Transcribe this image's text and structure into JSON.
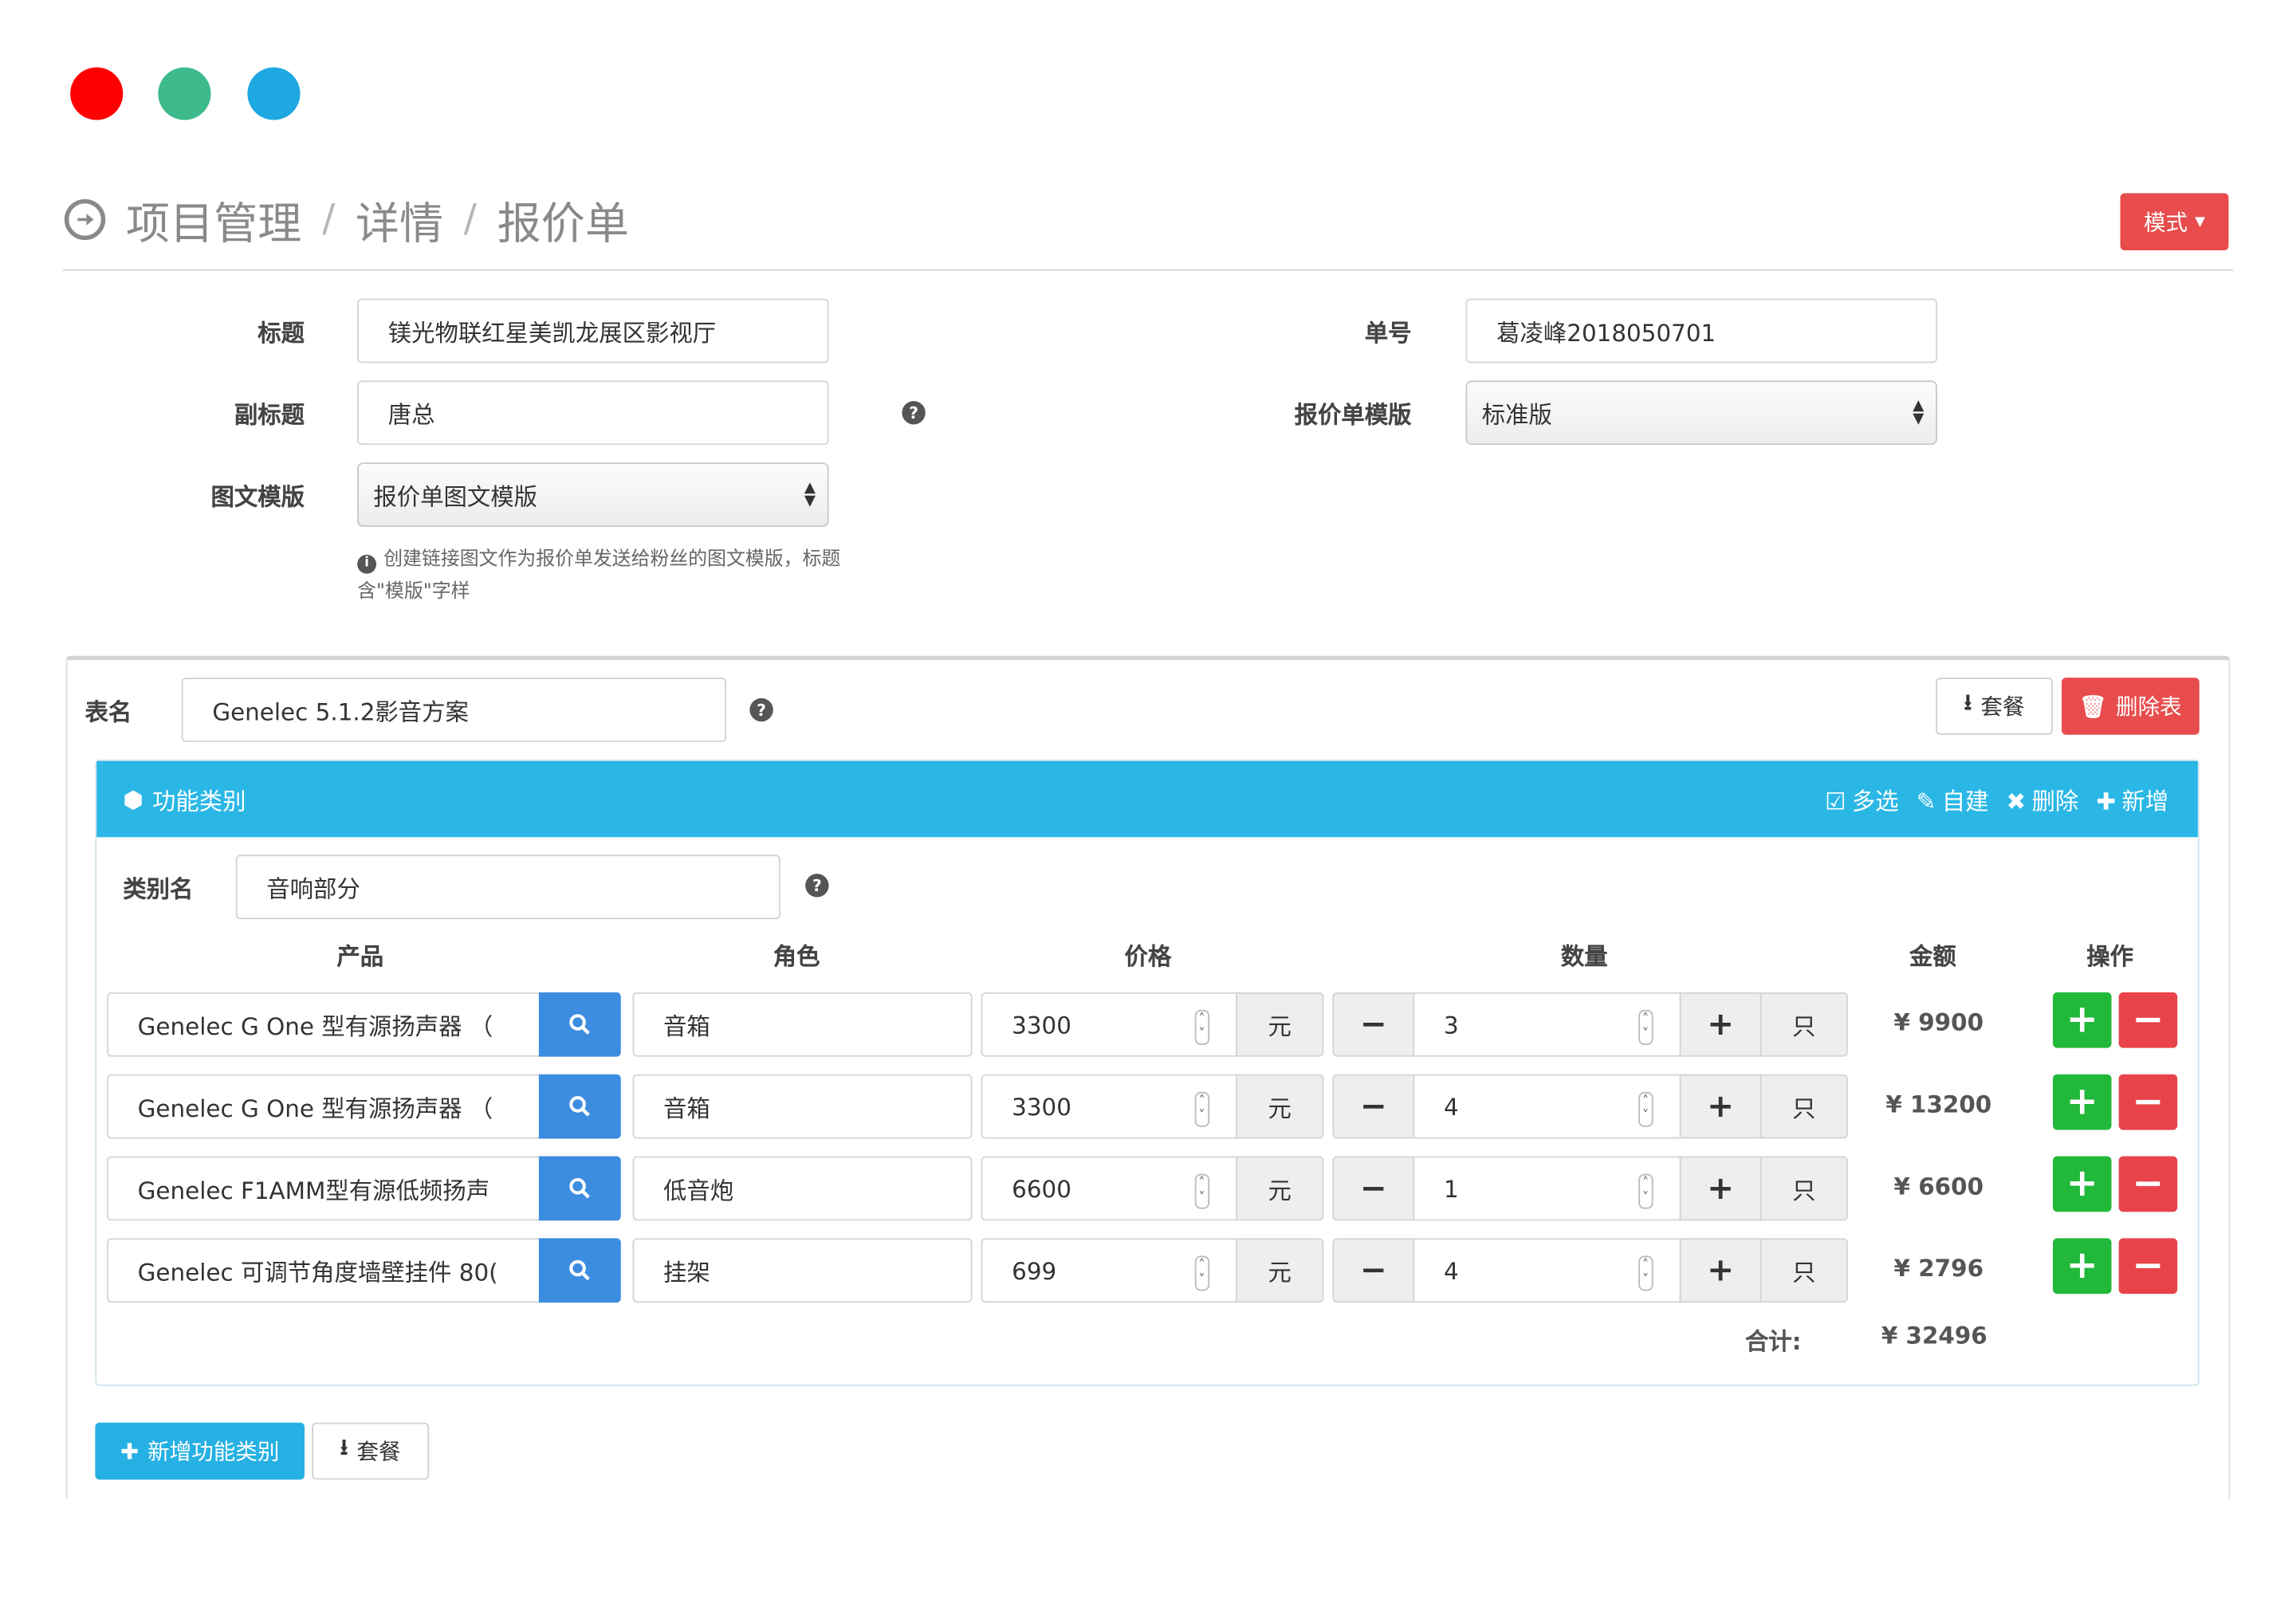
{
  "window_controls": {
    "close_color": "#ff0000",
    "min_color": "#3dba8c",
    "max_color": "#1ea8e2"
  },
  "breadcrumb": {
    "items": [
      "项目管理",
      "详情",
      "报价单"
    ],
    "separator": "/"
  },
  "mode_button": {
    "label": "模式",
    "color": "#e84c4c"
  },
  "form": {
    "title_label": "标题",
    "title_value": "镁光物联红星美凯龙展区影视厅",
    "order_no_label": "单号",
    "order_no_value": "葛凌峰2018050701",
    "subtitle_label": "副标题",
    "subtitle_value": "唐总",
    "template_label": "报价单模版",
    "template_value": "标准版",
    "graphic_template_label": "图文模版",
    "graphic_template_value": "报价单图文模版",
    "help_text": "创建链接图文作为报价单发送给粉丝的图文模版，标题含\"模版\"字样"
  },
  "sheet": {
    "name_label": "表名",
    "name_value": "Genelec 5.1.2影音方案",
    "package_label": "套餐",
    "delete_label": "删除表",
    "category": {
      "header_title": "功能类别",
      "actions": {
        "multi_select": "多选",
        "custom": "自建",
        "delete": "删除",
        "add": "新增"
      },
      "name_label": "类别名",
      "name_value": "音响部分",
      "columns": {
        "product": "产品",
        "role": "角色",
        "price": "价格",
        "quantity": "数量",
        "amount": "金额",
        "actions": "操作"
      },
      "rows": [
        {
          "product": "Genelec G One 型有源扬声器 （",
          "role": "音箱",
          "price": "3300",
          "price_unit": "元",
          "qty": "3",
          "qty_unit": "只",
          "amount": "¥ 9900"
        },
        {
          "product": "Genelec G One 型有源扬声器 （",
          "role": "音箱",
          "price": "3300",
          "price_unit": "元",
          "qty": "4",
          "qty_unit": "只",
          "amount": "¥ 13200"
        },
        {
          "product": "Genelec F1AMM型有源低频扬声",
          "role": "低音炮",
          "price": "6600",
          "price_unit": "元",
          "qty": "1",
          "qty_unit": "只",
          "amount": "¥ 6600"
        },
        {
          "product": "Genelec 可调节角度墙壁挂件 80(",
          "role": "挂架",
          "price": "699",
          "price_unit": "元",
          "qty": "4",
          "qty_unit": "只",
          "amount": "¥ 2796"
        }
      ],
      "total_label": "合计:",
      "total_value": "¥ 32496"
    }
  },
  "footer": {
    "add_category_label": "新增功能类别",
    "package_label": "套餐"
  }
}
